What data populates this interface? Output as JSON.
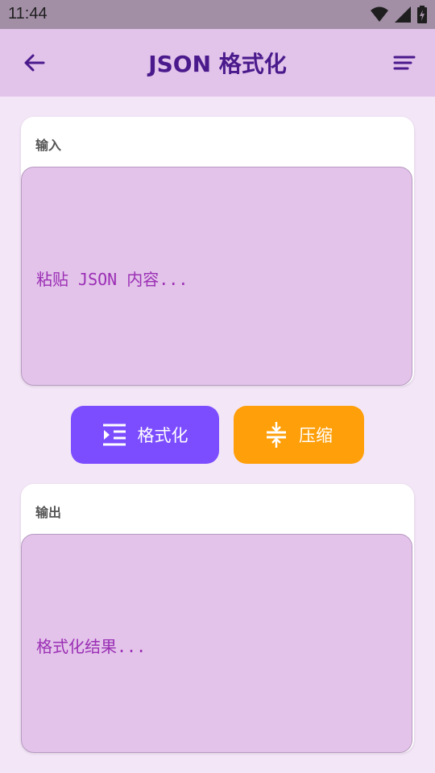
{
  "status": {
    "time": "11:44"
  },
  "appbar": {
    "title": "JSON 格式化"
  },
  "input": {
    "label": "输入",
    "placeholder": "粘贴 JSON 内容..."
  },
  "actions": {
    "format_label": "格式化",
    "compress_label": "压缩"
  },
  "output": {
    "label": "输出",
    "placeholder": "格式化结果..."
  },
  "colors": {
    "appbar": "#e2c3ea",
    "title": "#4a1a8c",
    "format_button": "#7c4dff",
    "compress_button": "#ff9f0a",
    "textarea_bg": "#e3c3ea",
    "placeholder": "#9b2fb5"
  },
  "icons": {
    "back": "arrow-back-icon",
    "menu": "sort-lines-icon",
    "format": "format-indent-icon",
    "compress": "compress-vertical-icon",
    "wifi": "wifi-icon",
    "signal": "signal-icon",
    "battery": "battery-icon"
  }
}
